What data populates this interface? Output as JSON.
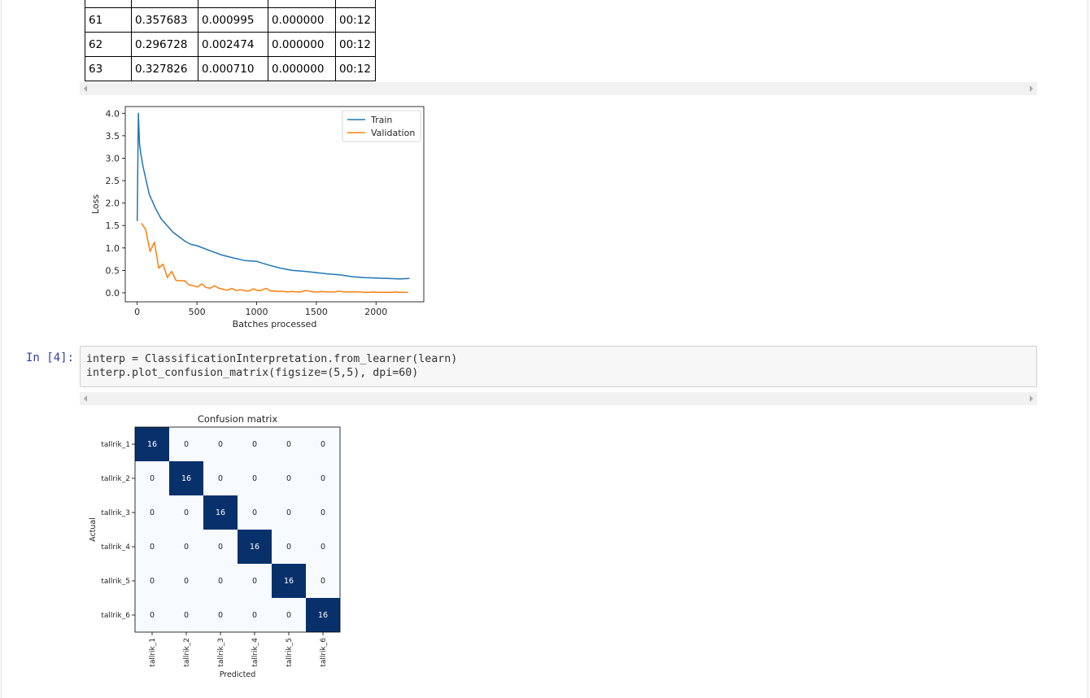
{
  "results_table": {
    "rows": [
      [
        "61",
        "0.357683",
        "0.000995",
        "0.000000",
        "00:12"
      ],
      [
        "62",
        "0.296728",
        "0.002474",
        "0.000000",
        "00:12"
      ],
      [
        "63",
        "0.327826",
        "0.000710",
        "0.000000",
        "00:12"
      ]
    ]
  },
  "code_cell": {
    "prompt": "In [4]:",
    "lines": [
      "interp = ClassificationInterpretation.from_learner(learn)",
      "interp.plot_confusion_matrix(figsize=(5,5), dpi=60)"
    ]
  },
  "chart_data": [
    {
      "type": "line",
      "xlabel": "Batches processed",
      "ylabel": "Loss",
      "xlim": [
        -100,
        2400
      ],
      "ylim": [
        -0.2,
        4.15
      ],
      "xticks": [
        "0",
        "500",
        "1000",
        "1500",
        "2000"
      ],
      "yticks": [
        "0.0",
        "0.5",
        "1.0",
        "1.5",
        "2.0",
        "2.5",
        "3.0",
        "3.5",
        "4.0"
      ],
      "legend_position": "top-right",
      "series": [
        {
          "name": "Train",
          "color": "#1f77b4",
          "x": [
            0,
            10,
            20,
            30,
            50,
            75,
            100,
            150,
            200,
            250,
            300,
            350,
            400,
            450,
            500,
            600,
            700,
            800,
            900,
            1000,
            1100,
            1200,
            1300,
            1400,
            1500,
            1600,
            1700,
            1800,
            1900,
            2000,
            2100,
            2200,
            2280
          ],
          "y": [
            1.6,
            4.0,
            3.3,
            3.1,
            2.8,
            2.5,
            2.2,
            1.9,
            1.65,
            1.5,
            1.35,
            1.25,
            1.15,
            1.08,
            1.05,
            0.95,
            0.85,
            0.78,
            0.72,
            0.7,
            0.62,
            0.55,
            0.5,
            0.48,
            0.45,
            0.42,
            0.4,
            0.36,
            0.34,
            0.33,
            0.32,
            0.31,
            0.32
          ]
        },
        {
          "name": "Validation",
          "color": "#ff7f0e",
          "x": [
            36,
            72,
            108,
            144,
            180,
            216,
            252,
            288,
            324,
            360,
            396,
            432,
            468,
            504,
            540,
            576,
            612,
            648,
            684,
            720,
            756,
            792,
            828,
            864,
            900,
            936,
            972,
            1008,
            1044,
            1080,
            1116,
            1152,
            1188,
            1224,
            1260,
            1296,
            1332,
            1368,
            1404,
            1440,
            1476,
            1512,
            1548,
            1584,
            1620,
            1656,
            1692,
            1728,
            1764,
            1800,
            1836,
            1872,
            1908,
            1944,
            1980,
            2016,
            2052,
            2088,
            2124,
            2160,
            2196,
            2232,
            2268
          ],
          "y": [
            1.55,
            1.4,
            0.92,
            1.13,
            0.55,
            0.64,
            0.34,
            0.48,
            0.28,
            0.27,
            0.27,
            0.18,
            0.16,
            0.13,
            0.2,
            0.12,
            0.1,
            0.16,
            0.1,
            0.08,
            0.06,
            0.1,
            0.05,
            0.07,
            0.05,
            0.04,
            0.09,
            0.05,
            0.06,
            0.1,
            0.04,
            0.04,
            0.03,
            0.03,
            0.02,
            0.03,
            0.02,
            0.02,
            0.05,
            0.04,
            0.02,
            0.02,
            0.03,
            0.02,
            0.02,
            0.02,
            0.04,
            0.02,
            0.02,
            0.02,
            0.02,
            0.02,
            0.01,
            0.01,
            0.02,
            0.01,
            0.01,
            0.01,
            0.01,
            0.02,
            0.01,
            0.01,
            0.01
          ]
        }
      ]
    },
    {
      "type": "heatmap",
      "title": "Confusion matrix",
      "xlabel": "Predicted",
      "ylabel": "Actual",
      "labels": [
        "tallrik_1",
        "tallrik_2",
        "tallrik_3",
        "tallrik_4",
        "tallrik_5",
        "tallrik_6"
      ],
      "values": [
        [
          16,
          0,
          0,
          0,
          0,
          0
        ],
        [
          0,
          16,
          0,
          0,
          0,
          0
        ],
        [
          0,
          0,
          16,
          0,
          0,
          0
        ],
        [
          0,
          0,
          0,
          16,
          0,
          0
        ],
        [
          0,
          0,
          0,
          0,
          16,
          0
        ],
        [
          0,
          0,
          0,
          0,
          0,
          16
        ]
      ],
      "colormap": {
        "high": "#08306b",
        "low": "#f7fbff"
      }
    }
  ]
}
